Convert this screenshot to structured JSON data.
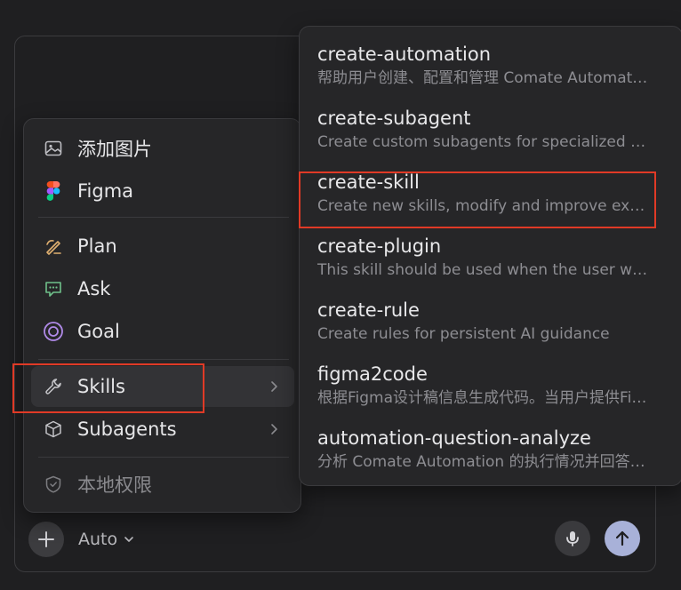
{
  "menu": {
    "items": [
      {
        "label": "添加图片",
        "icon": "image-icon"
      },
      {
        "label": "Figma",
        "icon": "figma-icon"
      },
      {
        "label": "Plan",
        "icon": "plan-icon"
      },
      {
        "label": "Ask",
        "icon": "chat-icon"
      },
      {
        "label": "Goal",
        "icon": "target-icon"
      },
      {
        "label": "Skills",
        "icon": "wrench-icon"
      },
      {
        "label": "Subagents",
        "icon": "cube-icon"
      },
      {
        "label": "本地权限",
        "icon": "shield-icon"
      }
    ]
  },
  "skills": [
    {
      "name": "create-automation",
      "description": "帮助用户创建、配置和管理 Comate Automation"
    },
    {
      "name": "create-subagent",
      "description": "Create custom subagents for specialized tasks"
    },
    {
      "name": "create-skill",
      "description": "Create new skills, modify and improve existing skills"
    },
    {
      "name": "create-plugin",
      "description": "This skill should be used when the user wants to create a plugin"
    },
    {
      "name": "create-rule",
      "description": "Create rules for persistent AI guidance"
    },
    {
      "name": "figma2code",
      "description": "根据Figma设计稿信息生成代码。当用户提供Figma链接时使用"
    },
    {
      "name": "automation-question-analyze",
      "description": "分析 Comate Automation 的执行情况并回答问题"
    }
  ],
  "input": {
    "mode_label": "Auto"
  },
  "colors": {
    "highlight": "#e03a26",
    "send_button": "#a8b1d8",
    "figma_red": "#f24e1e",
    "figma_purple": "#a259ff",
    "figma_blue": "#1abcfe",
    "figma_green": "#0acf83",
    "plan_icon": "#e0b070",
    "ask_icon": "#6fc08a",
    "goal_icon": "#b08ae8"
  }
}
